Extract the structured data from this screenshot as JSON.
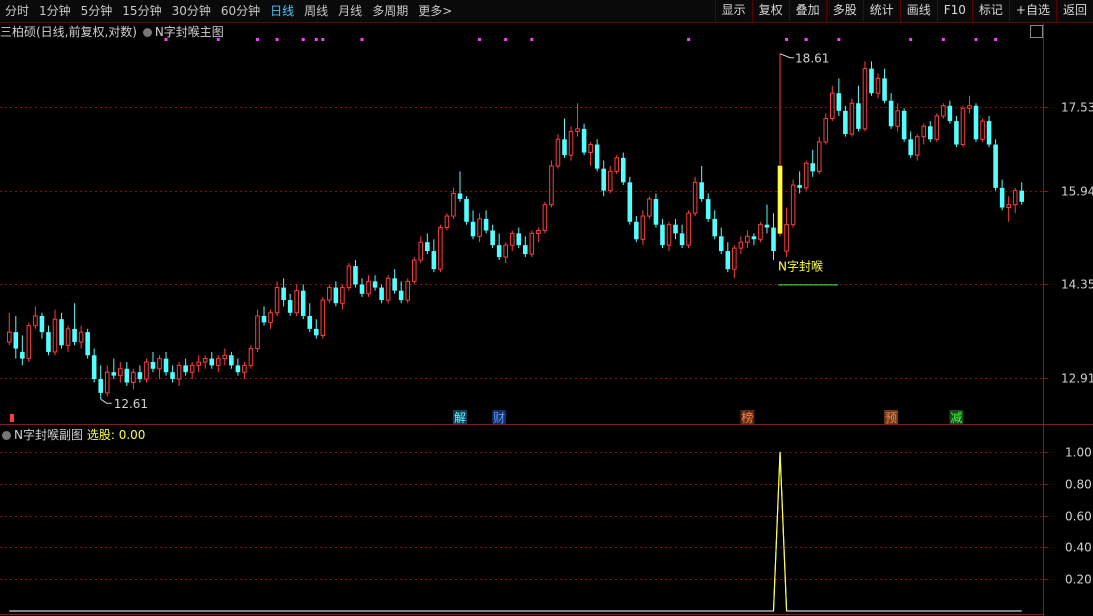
{
  "toolbar": {
    "periods": [
      "分时",
      "1分钟",
      "5分钟",
      "15分钟",
      "30分钟",
      "60分钟",
      "日线",
      "周线",
      "月线",
      "多周期",
      "更多>"
    ],
    "active_period": "日线",
    "actions": [
      "显示",
      "复权",
      "叠加",
      "多股",
      "统计",
      "画线",
      "F10",
      "标记",
      "+自选",
      "返回"
    ]
  },
  "main_title": {
    "stock": "三柏硕(日线,前复权,对数)",
    "indicator": "N字封喉主图"
  },
  "sub_title": {
    "indicator": "N字封喉副图",
    "label": "选股:",
    "value": "0.00"
  },
  "colors": {
    "up": "#ff3c3c",
    "down": "#54ffff",
    "grid": "#8a1010",
    "signal": "#ffff40",
    "marker": "#ff3cff"
  },
  "chart_data": [
    {
      "type": "candlestick",
      "y_scale": "log",
      "ylim": [
        12.5,
        18.9
      ],
      "y_ticks": [
        "17.53",
        "15.94",
        "14.35",
        "12.91"
      ],
      "y_tick_values": [
        17.53,
        15.94,
        14.35,
        12.91
      ],
      "annotations": {
        "high": "18.61",
        "low": "12.61",
        "signal_label": "N字封喉"
      },
      "event_markers": [
        {
          "text": "解",
          "bar": 69
        },
        {
          "text": "财",
          "bar": 75
        },
        {
          "text": "榜",
          "bar": 113
        },
        {
          "text": "预",
          "bar": 135
        },
        {
          "text": "减",
          "bar": 145
        }
      ],
      "signal_bar": 117,
      "ohlc": [
        [
          13.45,
          13.9,
          13.4,
          13.6
        ],
        [
          13.6,
          13.85,
          13.2,
          13.35
        ],
        [
          13.3,
          13.55,
          13.1,
          13.2
        ],
        [
          13.2,
          13.75,
          13.15,
          13.7
        ],
        [
          13.7,
          14.0,
          13.65,
          13.85
        ],
        [
          13.85,
          13.9,
          13.5,
          13.6
        ],
        [
          13.6,
          13.7,
          13.25,
          13.3
        ],
        [
          13.3,
          13.95,
          13.25,
          13.8
        ],
        [
          13.8,
          13.9,
          13.35,
          13.4
        ],
        [
          13.4,
          13.7,
          13.3,
          13.65
        ],
        [
          13.65,
          14.05,
          13.4,
          13.45
        ],
        [
          13.45,
          13.7,
          13.35,
          13.6
        ],
        [
          13.6,
          13.65,
          13.2,
          13.25
        ],
        [
          13.25,
          13.35,
          12.85,
          12.9
        ],
        [
          12.9,
          13.1,
          12.61,
          12.7
        ],
        [
          12.7,
          13.1,
          12.65,
          13.0
        ],
        [
          13.0,
          13.2,
          12.9,
          12.95
        ],
        [
          12.95,
          13.15,
          12.85,
          13.05
        ],
        [
          13.05,
          13.15,
          12.8,
          12.85
        ],
        [
          12.85,
          13.05,
          12.75,
          13.0
        ],
        [
          13.0,
          13.1,
          12.85,
          12.9
        ],
        [
          12.9,
          13.2,
          12.85,
          13.15
        ],
        [
          13.15,
          13.3,
          13.0,
          13.05
        ],
        [
          13.05,
          13.25,
          12.9,
          13.2
        ],
        [
          13.2,
          13.3,
          12.95,
          13.0
        ],
        [
          13.0,
          13.1,
          12.85,
          12.9
        ],
        [
          12.9,
          13.15,
          12.8,
          13.1
        ],
        [
          13.1,
          13.2,
          12.95,
          13.0
        ],
        [
          13.0,
          13.15,
          12.9,
          13.1
        ],
        [
          13.1,
          13.25,
          13.0,
          13.15
        ],
        [
          13.15,
          13.25,
          13.05,
          13.2
        ],
        [
          13.2,
          13.3,
          13.05,
          13.1
        ],
        [
          13.1,
          13.25,
          13.0,
          13.2
        ],
        [
          13.2,
          13.35,
          13.1,
          13.25
        ],
        [
          13.25,
          13.3,
          13.05,
          13.1
        ],
        [
          13.1,
          13.2,
          12.95,
          13.0
        ],
        [
          13.0,
          13.15,
          12.9,
          13.1
        ],
        [
          13.1,
          13.4,
          13.05,
          13.35
        ],
        [
          13.35,
          13.95,
          13.3,
          13.85
        ],
        [
          13.85,
          14.0,
          13.7,
          13.75
        ],
        [
          13.75,
          13.95,
          13.65,
          13.9
        ],
        [
          13.9,
          14.4,
          13.85,
          14.3
        ],
        [
          14.3,
          14.45,
          14.0,
          14.1
        ],
        [
          14.1,
          14.2,
          13.85,
          13.9
        ],
        [
          13.9,
          14.35,
          13.85,
          14.25
        ],
        [
          14.25,
          14.35,
          13.8,
          13.85
        ],
        [
          13.85,
          14.05,
          13.6,
          13.65
        ],
        [
          13.65,
          13.8,
          13.5,
          13.55
        ],
        [
          13.55,
          14.15,
          13.5,
          14.1
        ],
        [
          14.1,
          14.35,
          14.05,
          14.3
        ],
        [
          14.3,
          14.4,
          14.0,
          14.05
        ],
        [
          14.05,
          14.35,
          13.95,
          14.3
        ],
        [
          14.3,
          14.7,
          14.25,
          14.65
        ],
        [
          14.65,
          14.75,
          14.3,
          14.35
        ],
        [
          14.35,
          14.45,
          14.15,
          14.2
        ],
        [
          14.2,
          14.5,
          14.15,
          14.4
        ],
        [
          14.4,
          14.5,
          14.25,
          14.3
        ],
        [
          14.3,
          14.35,
          14.05,
          14.1
        ],
        [
          14.1,
          14.5,
          14.05,
          14.45
        ],
        [
          14.45,
          14.6,
          14.2,
          14.25
        ],
        [
          14.25,
          14.4,
          14.05,
          14.1
        ],
        [
          14.1,
          14.45,
          14.05,
          14.4
        ],
        [
          14.4,
          14.8,
          14.35,
          14.75
        ],
        [
          14.75,
          15.15,
          14.7,
          15.05
        ],
        [
          15.05,
          15.2,
          14.85,
          14.9
        ],
        [
          14.9,
          15.1,
          14.55,
          14.6
        ],
        [
          14.6,
          15.35,
          14.55,
          15.3
        ],
        [
          15.3,
          15.55,
          15.25,
          15.5
        ],
        [
          15.5,
          16.0,
          15.45,
          15.9
        ],
        [
          15.9,
          16.3,
          15.75,
          15.8
        ],
        [
          15.8,
          15.85,
          15.35,
          15.4
        ],
        [
          15.4,
          15.6,
          15.1,
          15.15
        ],
        [
          15.15,
          15.55,
          15.05,
          15.45
        ],
        [
          15.45,
          15.6,
          15.2,
          15.25
        ],
        [
          15.25,
          15.35,
          14.95,
          15.0
        ],
        [
          15.0,
          15.2,
          14.75,
          14.8
        ],
        [
          14.8,
          15.05,
          14.7,
          15.0
        ],
        [
          15.0,
          15.25,
          14.9,
          15.2
        ],
        [
          15.2,
          15.3,
          14.95,
          15.0
        ],
        [
          15.0,
          15.15,
          14.8,
          14.85
        ],
        [
          14.85,
          15.25,
          14.8,
          15.2
        ],
        [
          15.2,
          15.3,
          15.05,
          15.25
        ],
        [
          15.25,
          15.75,
          15.2,
          15.7
        ],
        [
          15.7,
          16.5,
          15.65,
          16.4
        ],
        [
          16.4,
          17.0,
          16.35,
          16.9
        ],
        [
          16.9,
          17.3,
          16.55,
          16.6
        ],
        [
          16.6,
          17.15,
          16.5,
          17.05
        ],
        [
          17.05,
          17.6,
          16.95,
          17.1
        ],
        [
          17.1,
          17.2,
          16.6,
          16.65
        ],
        [
          16.65,
          16.85,
          16.4,
          16.8
        ],
        [
          16.8,
          16.9,
          16.3,
          16.35
        ],
        [
          16.35,
          16.5,
          15.85,
          15.95
        ],
        [
          15.95,
          16.4,
          15.9,
          16.3
        ],
        [
          16.3,
          16.6,
          16.25,
          16.55
        ],
        [
          16.55,
          16.65,
          16.05,
          16.1
        ],
        [
          16.1,
          16.2,
          15.35,
          15.4
        ],
        [
          15.4,
          15.5,
          15.05,
          15.1
        ],
        [
          15.1,
          15.6,
          15.0,
          15.5
        ],
        [
          15.5,
          15.85,
          15.45,
          15.8
        ],
        [
          15.8,
          15.9,
          15.3,
          15.35
        ],
        [
          15.35,
          15.45,
          14.95,
          15.0
        ],
        [
          15.0,
          15.4,
          14.9,
          15.35
        ],
        [
          15.35,
          15.45,
          15.1,
          15.2
        ],
        [
          15.2,
          15.35,
          14.95,
          15.0
        ],
        [
          15.0,
          15.6,
          14.95,
          15.55
        ],
        [
          15.55,
          16.2,
          15.5,
          16.1
        ],
        [
          16.1,
          16.4,
          15.75,
          15.8
        ],
        [
          15.8,
          15.9,
          15.4,
          15.45
        ],
        [
          15.45,
          15.6,
          15.1,
          15.15
        ],
        [
          15.15,
          15.3,
          14.85,
          14.9
        ],
        [
          14.9,
          15.05,
          14.55,
          14.6
        ],
        [
          14.6,
          15.0,
          14.45,
          14.95
        ],
        [
          14.95,
          15.15,
          14.85,
          15.05
        ],
        [
          15.05,
          15.25,
          14.95,
          15.15
        ],
        [
          15.15,
          15.2,
          15.0,
          15.1
        ],
        [
          15.1,
          15.4,
          15.05,
          15.35
        ],
        [
          15.35,
          15.7,
          15.2,
          15.3
        ],
        [
          15.3,
          15.55,
          14.75,
          14.9
        ],
        [
          15.2,
          18.61,
          15.15,
          16.4
        ],
        [
          14.9,
          15.65,
          14.8,
          15.35
        ],
        [
          15.35,
          16.15,
          15.3,
          16.05
        ],
        [
          16.05,
          16.3,
          15.9,
          16.0
        ],
        [
          16.0,
          16.5,
          15.95,
          16.45
        ],
        [
          16.45,
          16.7,
          16.2,
          16.3
        ],
        [
          16.3,
          16.95,
          16.25,
          16.85
        ],
        [
          16.85,
          17.4,
          16.8,
          17.3
        ],
        [
          17.3,
          17.95,
          17.25,
          17.8
        ],
        [
          17.8,
          18.1,
          17.35,
          17.45
        ],
        [
          17.45,
          17.55,
          16.95,
          17.0
        ],
        [
          17.0,
          17.7,
          16.95,
          17.6
        ],
        [
          17.6,
          17.95,
          17.05,
          17.1
        ],
        [
          17.1,
          18.45,
          17.05,
          18.3
        ],
        [
          18.3,
          18.45,
          17.75,
          17.8
        ],
        [
          17.8,
          18.2,
          17.7,
          18.1
        ],
        [
          18.1,
          18.3,
          17.6,
          17.65
        ],
        [
          17.65,
          17.8,
          17.1,
          17.15
        ],
        [
          17.15,
          17.6,
          17.05,
          17.45
        ],
        [
          17.45,
          17.5,
          16.85,
          16.9
        ],
        [
          16.9,
          17.05,
          16.55,
          16.6
        ],
        [
          16.6,
          17.0,
          16.5,
          16.95
        ],
        [
          16.95,
          17.2,
          16.8,
          17.15
        ],
        [
          17.15,
          17.25,
          16.85,
          16.9
        ],
        [
          16.9,
          17.4,
          16.85,
          17.35
        ],
        [
          17.35,
          17.6,
          17.3,
          17.55
        ],
        [
          17.55,
          17.65,
          17.2,
          17.25
        ],
        [
          17.25,
          17.35,
          16.75,
          16.8
        ],
        [
          16.8,
          17.55,
          16.75,
          17.5
        ],
        [
          17.5,
          17.75,
          17.4,
          17.55
        ],
        [
          17.55,
          17.6,
          16.85,
          16.9
        ],
        [
          16.9,
          17.3,
          16.85,
          17.25
        ],
        [
          17.25,
          17.35,
          16.75,
          16.8
        ],
        [
          16.8,
          16.9,
          15.95,
          16.0
        ],
        [
          16.0,
          16.15,
          15.6,
          15.65
        ],
        [
          15.65,
          15.85,
          15.4,
          15.7
        ],
        [
          15.7,
          16.0,
          15.55,
          15.95
        ],
        [
          15.95,
          16.1,
          15.7,
          15.75
        ]
      ]
    },
    {
      "type": "line",
      "name": "选股",
      "ylim": [
        0,
        1.1
      ],
      "y_ticks": [
        "1.00",
        "0.80",
        "0.60",
        "0.40",
        "0.20"
      ],
      "y_tick_values": [
        1.0,
        0.8,
        0.6,
        0.4,
        0.2
      ],
      "signal_bar": 117,
      "value": 1.0
    }
  ]
}
